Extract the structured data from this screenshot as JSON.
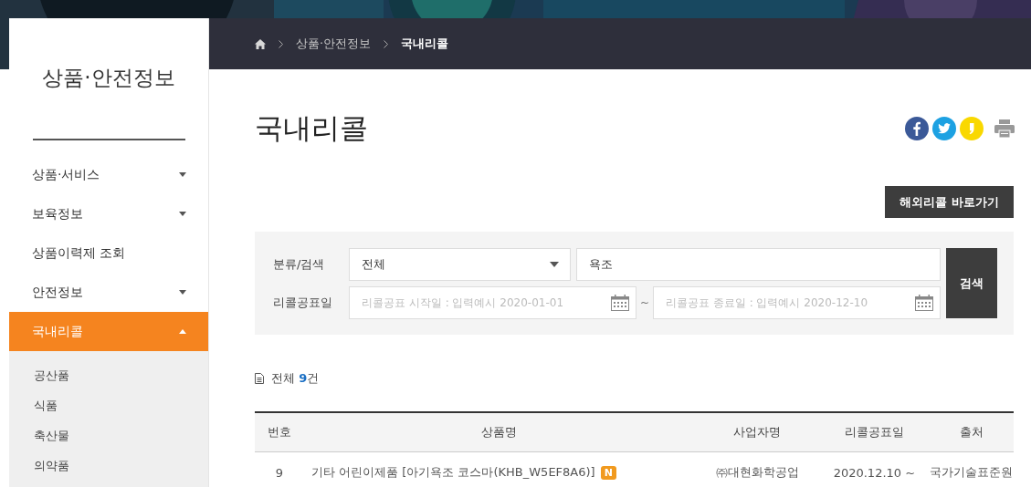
{
  "sidebar": {
    "title": "상품·안전정보",
    "items": [
      {
        "label": "상품·서비스",
        "kind": "group",
        "selected": false,
        "expanded": false
      },
      {
        "label": "보육정보",
        "kind": "group",
        "selected": false,
        "expanded": false
      },
      {
        "label": "상품이력제 조회",
        "kind": "link",
        "selected": false
      },
      {
        "label": "안전정보",
        "kind": "group",
        "selected": false,
        "expanded": false
      },
      {
        "label": "국내리콜",
        "kind": "group",
        "selected": true,
        "expanded": true,
        "children": [
          {
            "label": "공산품"
          },
          {
            "label": "식품"
          },
          {
            "label": "축산물"
          },
          {
            "label": "의약품"
          }
        ]
      }
    ]
  },
  "breadcrumb": [
    "상품·안전정보",
    "국내리콜"
  ],
  "page_title": "국내리콜",
  "overseas_button": "해외리콜 바로가기",
  "search": {
    "label": "분류/검색",
    "category": "전체",
    "keyword": "욕조",
    "date_label": "리콜공표일",
    "start_placeholder": "리콜공표 시작일 : 입력예시 2020-01-01",
    "separator": "~",
    "end_placeholder": "리콜공표 종료일 : 입력예시 2020-12-10",
    "button": "검색"
  },
  "count": {
    "prefix": "전체 ",
    "number": "9",
    "suffix": "건"
  },
  "table": {
    "columns": [
      "번호",
      "상품명",
      "사업자명",
      "리콜공표일",
      "출처"
    ],
    "rows": [
      {
        "cells": [
          "9",
          "기타 어린이제품 [아기욕조 코스마(KHB_W5EF8A6)]",
          "㈜대현화학공업",
          "2020.12.10 ~",
          "국가기술표준원"
        ],
        "badge": "N"
      }
    ]
  }
}
